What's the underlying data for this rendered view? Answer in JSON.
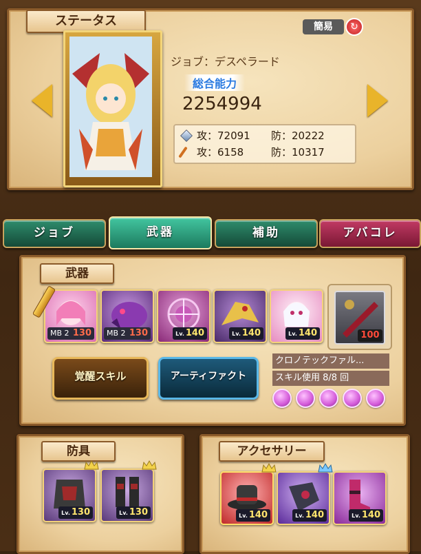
{
  "status": {
    "title": "ステータス",
    "simple_toggle": "簡易",
    "job_line": "ジョブ：デスペラード",
    "power_label": "総合能力",
    "power_value": "2254994",
    "phys_atk": "攻：72091",
    "phys_def": "防：20222",
    "mag_atk": "攻：6158",
    "mag_def": "防：10317"
  },
  "tabs": [
    {
      "label": "ジョブ",
      "color": "#1f6a52"
    },
    {
      "label": "武器",
      "color": "#2a9a7a"
    },
    {
      "label": "補助",
      "color": "#1f6a52"
    },
    {
      "label": "アバコレ",
      "color": "#a3244a"
    }
  ],
  "weapons": {
    "title": "武器",
    "cards": [
      {
        "mb": "MB 2",
        "level": "130",
        "bg": "#d96cb0",
        "icon": "pink-hair-girl-icon"
      },
      {
        "mb": "MB 2",
        "level": "130",
        "bg": "#7a3a9a",
        "icon": "purple-beast-icon"
      },
      {
        "lv_prefix": "Lv.",
        "level": "140",
        "bg": "#b0408a",
        "icon": "magic-circle-icon"
      },
      {
        "lv_prefix": "Lv.",
        "level": "140",
        "bg": "#7a4a9a",
        "icon": "golden-dragon-icon"
      },
      {
        "lv_prefix": "Lv.",
        "level": "140",
        "bg": "#e9a0c8",
        "icon": "white-hair-girl-icon"
      }
    ],
    "special": {
      "level": "100",
      "icon": "crimson-sword-icon"
    },
    "awaken_button": "覚醒スキル",
    "artifact_button": "アーティファクト",
    "skill_name": "クロノテックファル...",
    "skill_usage": "スキル使用 8/8 回",
    "gem_count": 5
  },
  "armor": {
    "title": "防具",
    "cards": [
      {
        "lv_prefix": "Lv.",
        "level": "130",
        "icon": "dark-armor-icon"
      },
      {
        "lv_prefix": "Lv.",
        "level": "130",
        "icon": "dark-greaves-icon"
      }
    ]
  },
  "accessory": {
    "title": "アクセサリー",
    "cards": [
      {
        "lv_prefix": "Lv.",
        "level": "140",
        "icon": "black-hat-icon"
      },
      {
        "lv_prefix": "Lv.",
        "level": "140",
        "icon": "gauntlet-icon"
      },
      {
        "lv_prefix": "Lv.",
        "level": "140",
        "icon": "pink-boots-icon"
      }
    ]
  }
}
